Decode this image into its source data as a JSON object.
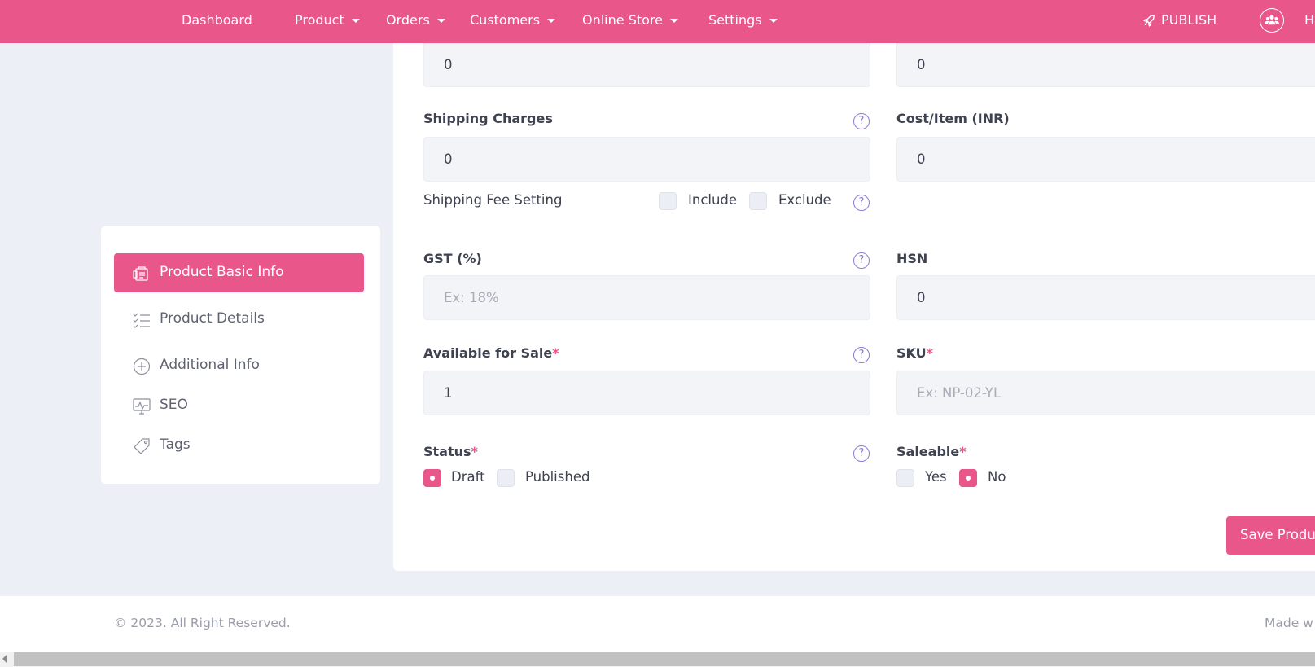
{
  "nav": {
    "items": [
      {
        "label": "Dashboard"
      },
      {
        "label": "Product"
      },
      {
        "label": "Orders"
      },
      {
        "label": "Customers"
      },
      {
        "label": "Online Store"
      },
      {
        "label": "Settings"
      }
    ],
    "publish_label": "PUBLISH",
    "user_initial": "H"
  },
  "sidebar": {
    "items": [
      {
        "label": "Product Basic Info",
        "icon": "product-info-icon",
        "active": true
      },
      {
        "label": "Product Details",
        "icon": "checklist-icon"
      },
      {
        "label": "Additional Info",
        "icon": "plus-circle-icon"
      },
      {
        "label": "SEO",
        "icon": "seo-monitor-icon"
      },
      {
        "label": "Tags",
        "icon": "tag-icon"
      }
    ]
  },
  "form": {
    "top_left_value": "0",
    "top_right_value": "0",
    "shipping_charges": {
      "label": "Shipping Charges",
      "value": "0"
    },
    "cost_item": {
      "label": "Cost/Item (INR)",
      "value": "0"
    },
    "shipping_fee_setting": {
      "label": "Shipping Fee Setting",
      "include": "Include",
      "exclude": "Exclude"
    },
    "gst": {
      "label": "GST (%)",
      "placeholder": "Ex: 18%"
    },
    "hsn": {
      "label": "HSN",
      "value": "0"
    },
    "available": {
      "label": "Available for Sale",
      "required": "*",
      "value": "1"
    },
    "sku": {
      "label": "SKU",
      "required": "*",
      "placeholder": "Ex: NP-02-YL"
    },
    "status": {
      "label": "Status",
      "required": "*",
      "draft": "Draft",
      "published": "Published",
      "selected": "Draft"
    },
    "saleable": {
      "label": "Saleable",
      "required": "*",
      "yes": "Yes",
      "no": "No",
      "selected": "No"
    },
    "help_glyph": "?",
    "save_label": "Save Product"
  },
  "footer": {
    "copyright": "© 2023. All Right Reserved.",
    "made": "Made w"
  },
  "colors": {
    "accent": "#e8568a",
    "help": "#8c79d8",
    "page_bg": "#edeff7"
  }
}
